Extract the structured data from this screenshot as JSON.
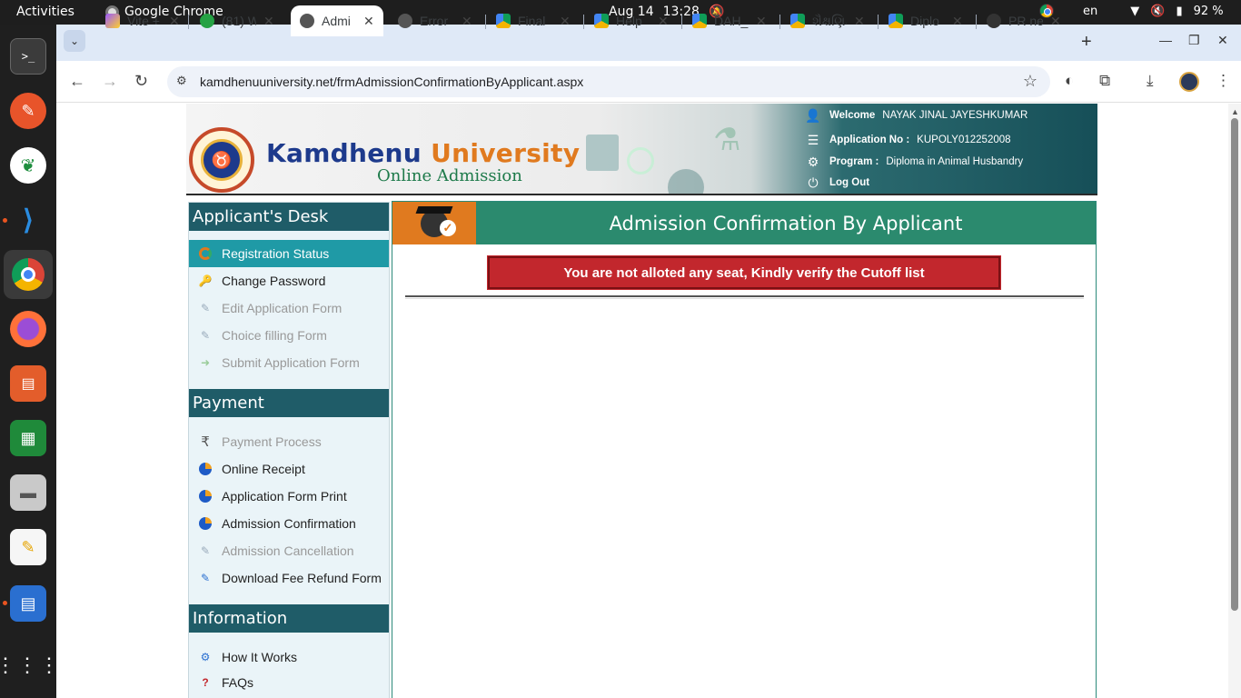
{
  "system_bar": {
    "activities": "Activities",
    "app_name": "Google Chrome",
    "date": "Aug 14",
    "time": "13:28",
    "language": "en",
    "battery": "92 %"
  },
  "browser": {
    "tabs": [
      {
        "title": "Vite +",
        "active": false
      },
      {
        "title": "(81) W",
        "active": false
      },
      {
        "title": "Admi",
        "active": true
      },
      {
        "title": "Error",
        "active": false
      },
      {
        "title": "Final",
        "active": false
      },
      {
        "title": "Help",
        "active": false
      },
      {
        "title": "DAH_",
        "active": false
      },
      {
        "title": "શૈક્ષણિક",
        "active": false
      },
      {
        "title": "Diplo",
        "active": false
      },
      {
        "title": "PR ne",
        "active": false
      }
    ],
    "url": "kamdhenuuniversity.net/frmAdmissionConfirmationByApplicant.aspx"
  },
  "header": {
    "brand_main": "Kamdhenu",
    "brand_uni": "University",
    "brand_sub": "Online Admission",
    "welcome_label": "Welcome",
    "welcome_value": "NAYAK JINAL JAYESHKUMAR",
    "application_label": "Application No :",
    "application_value": "KUPOLY012252008",
    "program_label": "Program :",
    "program_value": "Diploma in Animal Husbandry",
    "logout": "Log Out"
  },
  "sidebar": {
    "applicant_desk": {
      "title": "Applicant's Desk",
      "items": [
        {
          "label": "Registration Status",
          "state": "active"
        },
        {
          "label": "Change Password",
          "state": "enabled"
        },
        {
          "label": "Edit Application Form",
          "state": "disabled"
        },
        {
          "label": "Choice filling Form",
          "state": "disabled"
        },
        {
          "label": "Submit Application Form",
          "state": "disabled"
        }
      ]
    },
    "payment": {
      "title": "Payment",
      "items": [
        {
          "label": "Payment Process",
          "state": "disabled"
        },
        {
          "label": "Online Receipt",
          "state": "enabled"
        },
        {
          "label": "Application Form Print",
          "state": "enabled"
        },
        {
          "label": "Admission Confirmation",
          "state": "enabled"
        },
        {
          "label": "Admission Cancellation",
          "state": "disabled"
        },
        {
          "label": "Download Fee Refund Form",
          "state": "enabled"
        }
      ]
    },
    "information": {
      "title": "Information",
      "items": [
        {
          "label": "How It Works",
          "state": "enabled"
        },
        {
          "label": "FAQs",
          "state": "enabled"
        }
      ]
    }
  },
  "main": {
    "title": "Admission Confirmation By Applicant",
    "alert": "You are not alloted any seat, Kindly verify the Cutoff list"
  },
  "colors": {
    "teal_header": "#1f5c68",
    "active_item": "#1f9aa6",
    "title_bar": "#2b8a6e",
    "orange": "#e07a1f",
    "alert_red": "#c2272d"
  }
}
